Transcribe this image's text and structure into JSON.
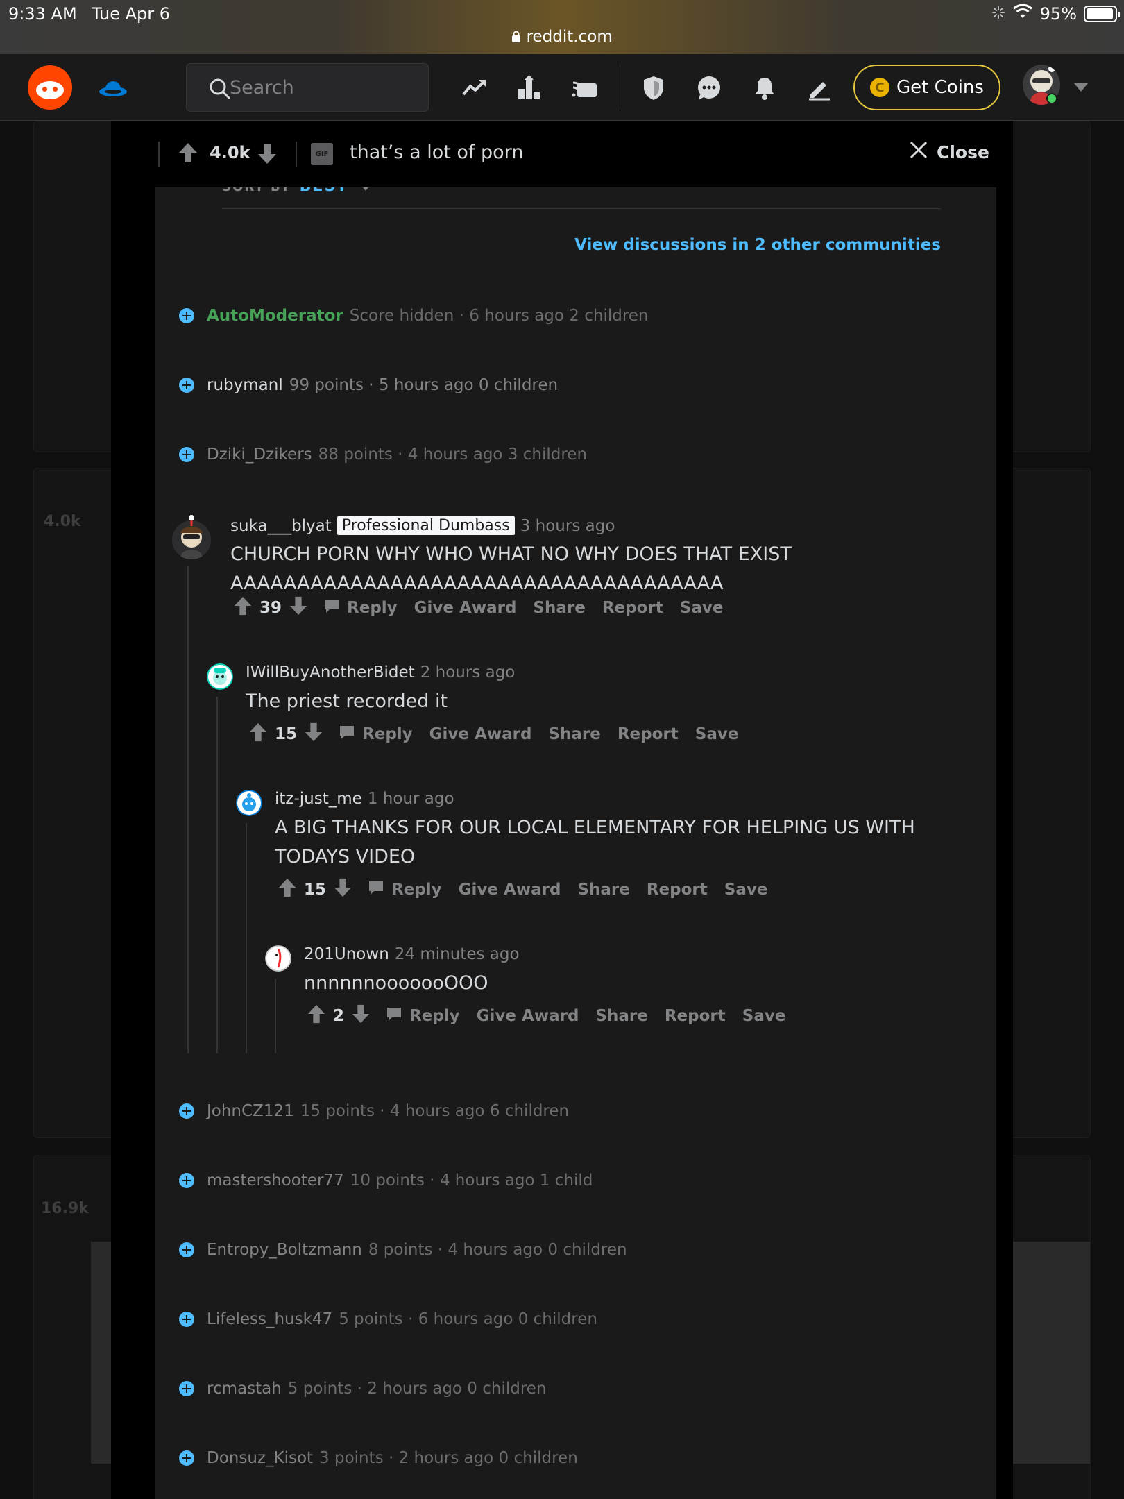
{
  "status": {
    "time": "9:33 AM",
    "date": "Tue Apr 6",
    "url": "reddit.com",
    "battery": "95%"
  },
  "header": {
    "search_placeholder": "Search",
    "coins_label": "Get Coins",
    "coin_symbol": "C"
  },
  "background": {
    "vote_1": "4.0k",
    "vote_2": "16.9k"
  },
  "post": {
    "score": "4.0k",
    "media_badge": "GIF",
    "title": "that’s a lot of porn",
    "close_label": "Close"
  },
  "comments_header": {
    "sort_label": "SORT BY",
    "sort_value": "BEST",
    "view_discussions": "View discussions in 2 other communities"
  },
  "collapsed_top": [
    {
      "author": "AutoModerator",
      "meta": "Score hidden · 6 hours ago  2 children"
    },
    {
      "author": "rubymanl",
      "meta": "99 points · 5 hours ago  0 children"
    },
    {
      "author": "Dziki_Dzikers",
      "meta": "88 points · 4 hours ago  3 children"
    }
  ],
  "thread": [
    {
      "author": "suka___blyat",
      "flair": "Professional Dumbass",
      "time": "3 hours ago",
      "body_lines": [
        "CHURCH PORN WHY WHO WHAT NO WHY DOES THAT EXIST",
        "AAAAAAAAAAAAAAAAAAAAAAAAAAAAAAAAAAAAA"
      ],
      "score": "39"
    },
    {
      "author": "IWillBuyAnotherBidet",
      "time": "2 hours ago",
      "body_lines": [
        "The priest recorded it"
      ],
      "score": "15"
    },
    {
      "author": "itz-just_me",
      "time": "1 hour ago",
      "body_lines": [
        "A BIG THANKS FOR OUR LOCAL ELEMENTARY FOR HELPING US WITH",
        "TODAYS VIDEO"
      ],
      "score": "15"
    },
    {
      "author": "201Unown",
      "time": "24 minutes ago",
      "body_lines": [
        "nnnnnnooooooOOO"
      ],
      "score": "2"
    }
  ],
  "actions": {
    "reply": "Reply",
    "give_award": "Give Award",
    "share": "Share",
    "report": "Report",
    "save": "Save"
  },
  "collapsed_bottom": [
    {
      "author": "JohnCZ121",
      "meta": "15 points · 4 hours ago  6 children"
    },
    {
      "author": "mastershooter77",
      "meta": "10 points · 4 hours ago  1 child"
    },
    {
      "author": "Entropy_Boltzmann",
      "meta": "8 points · 4 hours ago  0 children"
    },
    {
      "author": "Lifeless_husk47",
      "meta": "5 points · 6 hours ago  0 children"
    },
    {
      "author": "rcmastah",
      "meta": "5 points · 2 hours ago  0 children"
    },
    {
      "author": "Donsuz_Kisot",
      "meta": "3 points · 2 hours ago  0 children"
    }
  ],
  "colors": {
    "accent_blue": "#4fbcff",
    "reddit_orange": "#ff4500",
    "mod_green": "#46a256",
    "coin_gold": "#e2c53b"
  }
}
